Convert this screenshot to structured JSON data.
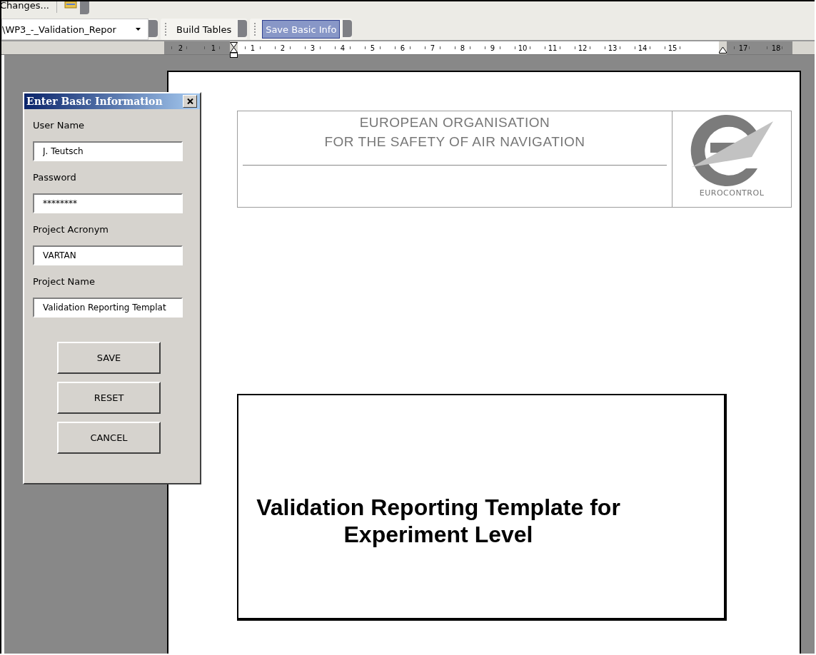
{
  "toolbar": {
    "row_1": {
      "button": "Changes..."
    },
    "row_2": {
      "document_dropdown": {
        "value": "\\WP3_-_Validation_Repor"
      },
      "buttons": [
        {
          "label": "Build Tables",
          "selected": false
        },
        {
          "label": "Save Basic Info",
          "selected": true
        }
      ]
    }
  },
  "ruler": {
    "left_numbers": [
      "2",
      "1"
    ],
    "numbers": [
      "1",
      "2",
      "3",
      "4",
      "5",
      "6",
      "7",
      "8",
      "9",
      "10",
      "11",
      "12",
      "13",
      "14",
      "15"
    ],
    "right_numbers": [
      "17",
      "18"
    ]
  },
  "dialog": {
    "title": "Enter Basic Information",
    "fields": [
      {
        "label": "User Name",
        "value": "J. Teutsch"
      },
      {
        "label": "Password",
        "value": "********"
      },
      {
        "label": "Project Acronym",
        "value": "VARTAN"
      },
      {
        "label": "Project Name",
        "value": "Validation Reporting Templat"
      }
    ],
    "buttons": [
      "SAVE",
      "RESET",
      "CANCEL"
    ]
  },
  "document": {
    "header": {
      "organisation_lines": [
        "EUROPEAN ORGANISATION",
        "FOR THE SAFETY OF AIR NAVIGATION"
      ],
      "logo_text": "EUROCONTROL"
    },
    "title_lines": [
      "Validation Reporting Template for",
      "Experiment Level"
    ]
  }
}
